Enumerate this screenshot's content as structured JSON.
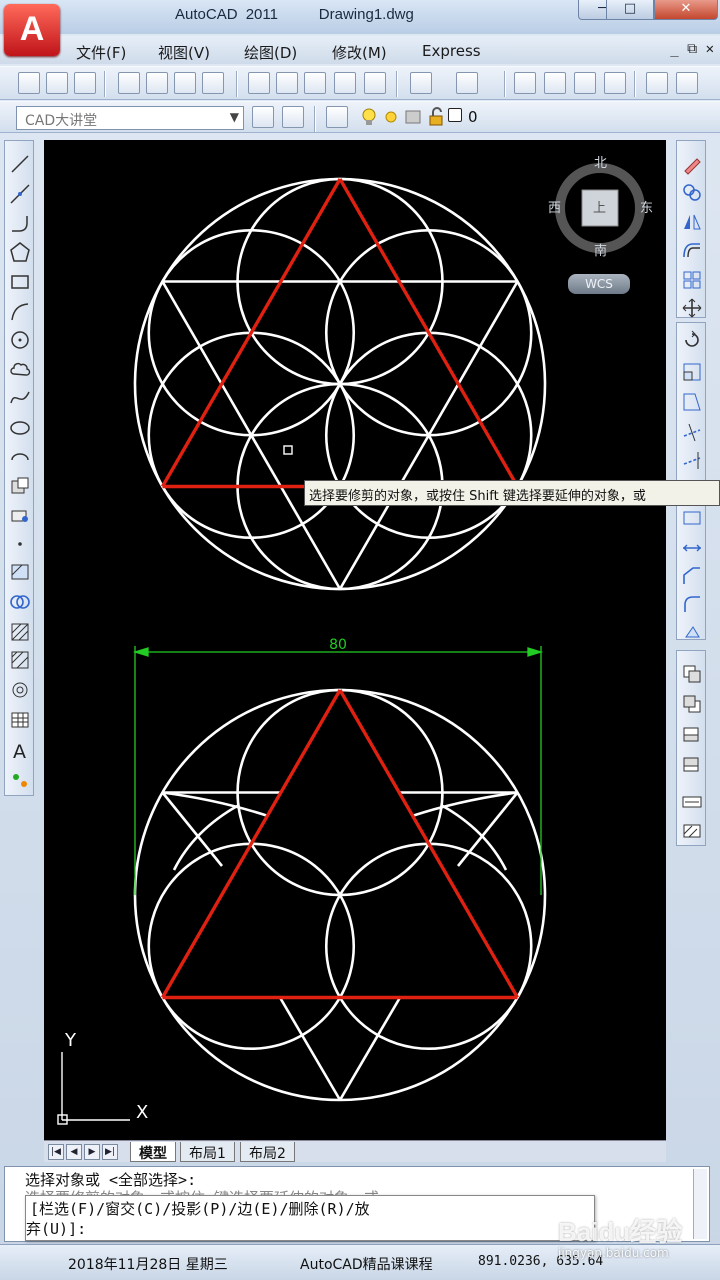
{
  "window": {
    "app_name": "AutoCAD 2011",
    "file_name": "Drawing1.dwg",
    "logo_letter": "A",
    "min_glyph": "─",
    "max_glyph": "□",
    "close_glyph": "✕"
  },
  "menu": {
    "items": [
      "文件(F)",
      "视图(V)",
      "绘图(D)",
      "修改(M)",
      "Express"
    ],
    "controls": "_ ⧉ ✕"
  },
  "toolbar2": {
    "workspace": "CAD大讲堂",
    "layer": "0"
  },
  "viewcube": {
    "north": "北",
    "south": "南",
    "west": "西",
    "east": "东",
    "face": "上",
    "wcs": "WCS"
  },
  "drawing": {
    "dimension_text": "80",
    "ucs_y": "Y",
    "ucs_x": "X"
  },
  "tooltip": {
    "text": "选择要修剪的对象，或按住 Shift 键选择要延伸的对象，或"
  },
  "layout_tabs": [
    "模型",
    "布局1",
    "布局2"
  ],
  "command": {
    "history_line": "选择对象或 <全部选择>:",
    "history_line2": "选择要修剪的对象，或按住        键选择要延伸的对象，或",
    "prompt_line1": "[栏选(F)/窗交(C)/投影(P)/边(E)/删除(R)/放",
    "prompt_line2": "弃(U)]:"
  },
  "statusbar": {
    "date": "2018年11月28日 星期三",
    "course": "AutoCAD精品课课程",
    "coords": "891.0236, 635.64"
  },
  "watermark": {
    "logo": "Baidu经验",
    "url": "jingyan.baidu.com"
  },
  "colors": {
    "canvas": "#000000",
    "geometry": "#ffffff",
    "highlight": "#e02010",
    "dimension": "#22cc22"
  }
}
